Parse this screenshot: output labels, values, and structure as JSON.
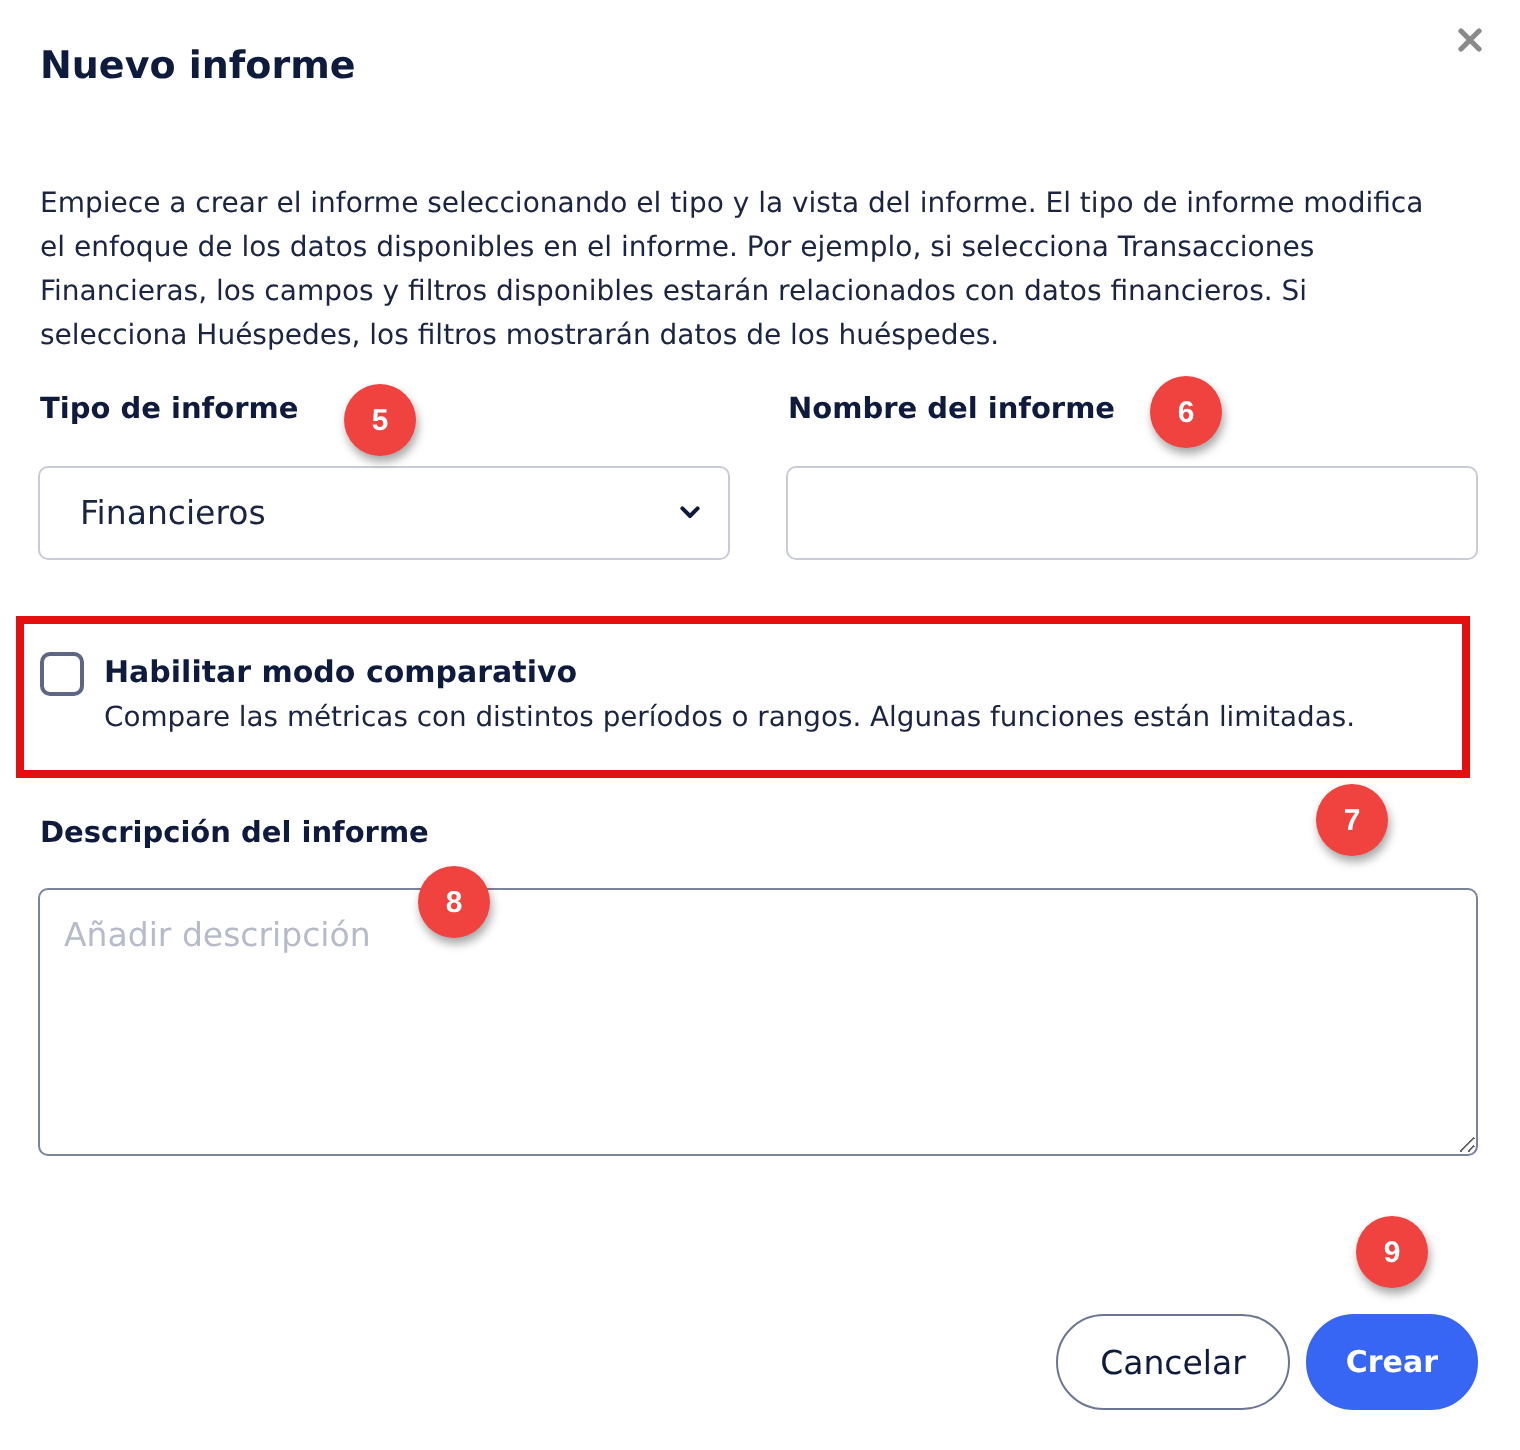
{
  "dialog": {
    "title": "Nuevo informe",
    "intro": "Empiece a crear el informe seleccionando el tipo y la vista del informe. El tipo de informe modifica el enfoque de los datos disponibles en el informe. Por ejemplo, si selecciona Transacciones Financieras, los campos y filtros disponibles estarán relacionados con datos financieros. Si selecciona Huéspedes, los filtros mostrarán datos de los huéspedes."
  },
  "fields": [
    {
      "label": "Tipo de informe",
      "kind": "select",
      "value": "Financieros",
      "marker": "5"
    },
    {
      "label": "Nombre del informe",
      "kind": "text",
      "marker": "6"
    }
  ],
  "comparative": {
    "label": "Habilitar modo comparativo",
    "hint": "Compare las métricas con distintos períodos o rangos. Algunas funciones están limitadas.",
    "checked": false,
    "highlighted": true,
    "marker": "7"
  },
  "description": {
    "label": "Descripción del informe",
    "placeholder": "Añadir descripción",
    "marker": "8"
  },
  "buttons": [
    {
      "label": "Cancelar",
      "kind": "secondary"
    },
    {
      "label": "Crear",
      "kind": "primary",
      "marker": "9"
    }
  ]
}
